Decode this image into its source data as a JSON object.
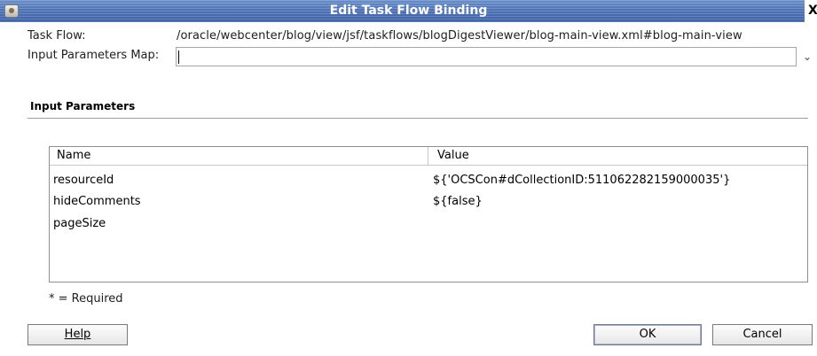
{
  "window": {
    "title": "Edit Task Flow Binding",
    "close_glyph": "X"
  },
  "form": {
    "task_flow_label": "Task Flow:",
    "task_flow_value": "/oracle/webcenter/blog/view/jsf/taskflows/blogDigestViewer/blog-main-view.xml#blog-main-view",
    "input_params_map_label": "Input Parameters Map:",
    "input_params_map_value": ""
  },
  "section": {
    "title": "Input Parameters"
  },
  "table": {
    "headers": [
      "Name",
      "Value"
    ],
    "rows": [
      {
        "name": "resourceId",
        "value": "${'OCSCon#dCollectionID:511062282159000035'}"
      },
      {
        "name": "hideComments",
        "value": "${false}"
      },
      {
        "name": "pageSize",
        "value": ""
      }
    ]
  },
  "required_note": "* = Required",
  "buttons": {
    "help": "Help",
    "ok": "OK",
    "cancel": "Cancel"
  },
  "icons": {
    "app": "coffee-cup-icon",
    "dropdown": "chevron-down-icon"
  }
}
